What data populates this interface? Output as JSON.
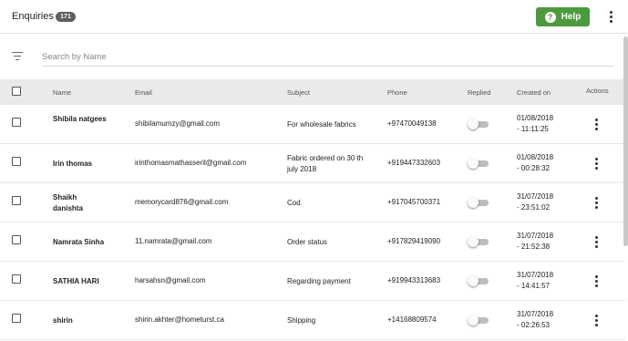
{
  "header": {
    "title": "Enquiries",
    "count": "171",
    "help_label": "Help",
    "help_icon": "question-icon"
  },
  "search": {
    "placeholder": "Search by Name",
    "value": ""
  },
  "table": {
    "columns": {
      "name": "Name",
      "email": "Email",
      "subject": "Subject",
      "phone": "Phone",
      "replied": "Replied",
      "created": "Created on",
      "actions": "Actions"
    },
    "rows": [
      {
        "name": "Shibila natgees",
        "email": "shibilamumzy@gmail.com",
        "subject": "For wholesale fabrics",
        "phone": "+97470049138",
        "replied": false,
        "date": "01/08/2018",
        "time": "- 11:11:25"
      },
      {
        "name": "Irin thomas",
        "email": "irinthomasmathasseril@gmail.com",
        "subject": "Fabric ordered on 30 th july 2018",
        "phone": "+919447332603",
        "replied": false,
        "date": "01/08/2018",
        "time": "- 00:28:32"
      },
      {
        "name": "Shaikh danishta",
        "email": "memorycard876@gmail.com",
        "subject": "Cod",
        "phone": "+917045700371",
        "replied": false,
        "date": "31/07/2018",
        "time": "- 23:51:02"
      },
      {
        "name": "Namrata Sinha",
        "email": "11.namrata@gmail.com",
        "subject": "Order status",
        "phone": "+917829419090",
        "replied": false,
        "date": "31/07/2018",
        "time": "- 21:52:38"
      },
      {
        "name": "SATHIA HARI",
        "email": "harsahsn@gmail.com",
        "subject": "Regarding payment",
        "phone": "+919943313683",
        "replied": false,
        "date": "31/07/2018",
        "time": "- 14:41:57"
      },
      {
        "name": "shirin",
        "email": "shirin.akhter@hometurst.ca",
        "subject": "Shipping",
        "phone": "+14168809574",
        "replied": false,
        "date": "31/07/2018",
        "time": "- 02:26:53"
      }
    ]
  },
  "colors": {
    "help_button": "#4c9a3c",
    "badge": "#5f5f5f",
    "header_row": "#eaeaea",
    "toggle_off": "#bdbdbd"
  }
}
